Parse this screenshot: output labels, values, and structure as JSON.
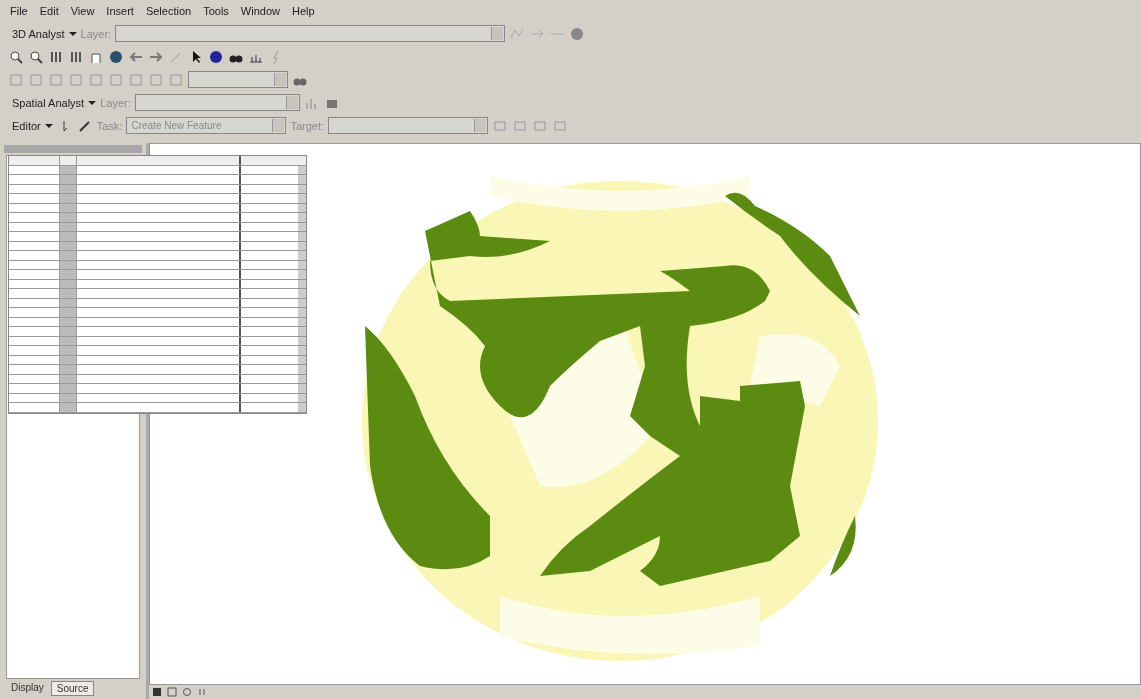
{
  "menu": [
    "File",
    "Edit",
    "View",
    "Insert",
    "Selection",
    "Tools",
    "Window",
    "Help"
  ],
  "analyst_toolbar": {
    "label": "3D Analyst",
    "layer_label": "Layer:"
  },
  "spatial_toolbar": {
    "label": "Spatial Analyst",
    "layer_label": "Layer:"
  },
  "editor_toolbar": {
    "label": "Editor",
    "task_label": "Task:",
    "task_value": "Create New Feature",
    "target_label": "Target:"
  },
  "panel_tabs": [
    {
      "label": "Display",
      "selected": false
    },
    {
      "label": "Source",
      "selected": true
    }
  ]
}
